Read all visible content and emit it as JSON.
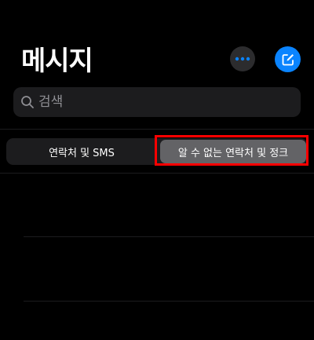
{
  "header": {
    "title": "메시지"
  },
  "toolbar": {
    "more_icon": "ellipsis-icon",
    "compose_icon": "compose-icon"
  },
  "search": {
    "placeholder": "검색",
    "value": ""
  },
  "filter": {
    "segments": [
      {
        "label": "연락처 및 SMS",
        "selected": false
      },
      {
        "label": "알 수 없는 연락처 및 정크",
        "selected": true
      }
    ]
  },
  "colors": {
    "background": "#000000",
    "accent": "#0a84ff",
    "highlight": "#ff0000"
  }
}
